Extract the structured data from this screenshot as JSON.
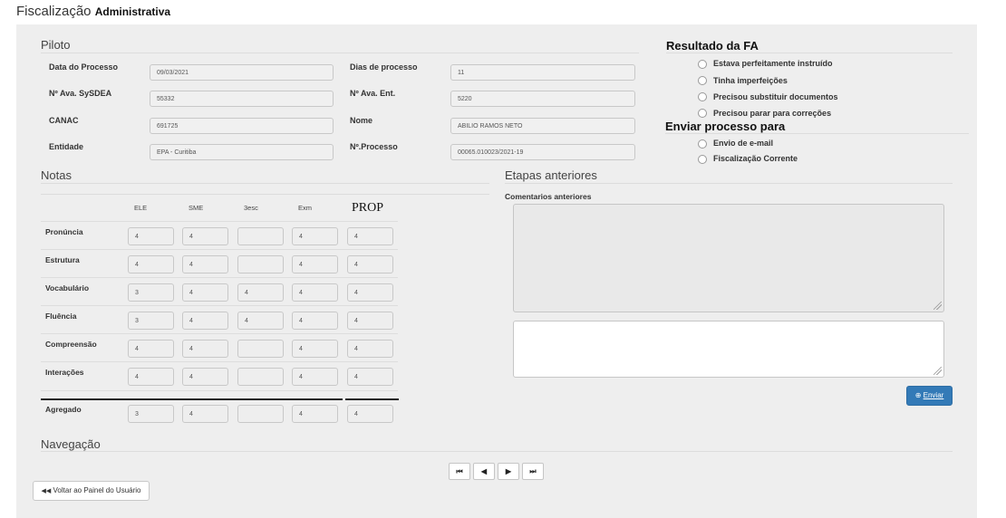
{
  "header": {
    "title": "Fiscalização",
    "subtitle": "Administrativa"
  },
  "piloto": {
    "title": "Piloto",
    "fields": {
      "data_processo": {
        "label": "Data do Processo",
        "value": "09/03/2021"
      },
      "dias_processo": {
        "label": "Dias de processo",
        "value": "11"
      },
      "n_ava_sysdea": {
        "label": "Nº Ava. SySDEA",
        "value": "55332"
      },
      "n_ava_ent": {
        "label": "Nº Ava. Ent.",
        "value": "5220"
      },
      "canac": {
        "label": "CANAC",
        "value": "691725"
      },
      "nome": {
        "label": "Nome",
        "value": "ABILIO RAMOS NETO"
      },
      "entidade": {
        "label": "Entidade",
        "value": "EPA - Curitiba"
      },
      "n_processo": {
        "label": "Nº.Processo",
        "value": "00065.010023/2021-19"
      }
    }
  },
  "resultado": {
    "title": "Resultado da FA",
    "options": [
      "Estava perfeitamente instruído",
      "Tinha imperfeições",
      "Precisou substituir documentos",
      "Precisou parar para correções"
    ]
  },
  "enviar": {
    "title": "Enviar processo para",
    "options": [
      "Envio de e-mail",
      "Fiscalização Corrente"
    ]
  },
  "notas": {
    "title": "Notas",
    "columns": [
      "ELE",
      "SME",
      "3esc",
      "Exm",
      "PROP"
    ],
    "rows": [
      {
        "label": "Pronúncia",
        "values": [
          "4",
          "4",
          "",
          "4",
          "4"
        ]
      },
      {
        "label": "Estrutura",
        "values": [
          "4",
          "4",
          "",
          "4",
          "4"
        ]
      },
      {
        "label": "Vocabulário",
        "values": [
          "3",
          "4",
          "4",
          "4",
          "4"
        ]
      },
      {
        "label": "Fluência",
        "values": [
          "3",
          "4",
          "4",
          "4",
          "4"
        ]
      },
      {
        "label": "Compreensão",
        "values": [
          "4",
          "4",
          "",
          "4",
          "4"
        ]
      },
      {
        "label": "Interações",
        "values": [
          "4",
          "4",
          "",
          "4",
          "4"
        ]
      }
    ],
    "aggregate": {
      "label": "Agregado",
      "values": [
        "3",
        "4",
        "",
        "4",
        "4"
      ]
    }
  },
  "etapas": {
    "title": "Etapas anteriores",
    "comments_label": "Comentarios anteriores",
    "send_label": "Enviar"
  },
  "navegacao": {
    "title": "Navegação",
    "pager": {
      "first": "⏮",
      "prev": "◀",
      "next": "▶",
      "last": "⏭"
    },
    "back_label": "Voltar ao Painel do Usuário"
  },
  "colors": {
    "panel_bg": "#eeeeee",
    "primary_button": "#337ab7"
  }
}
